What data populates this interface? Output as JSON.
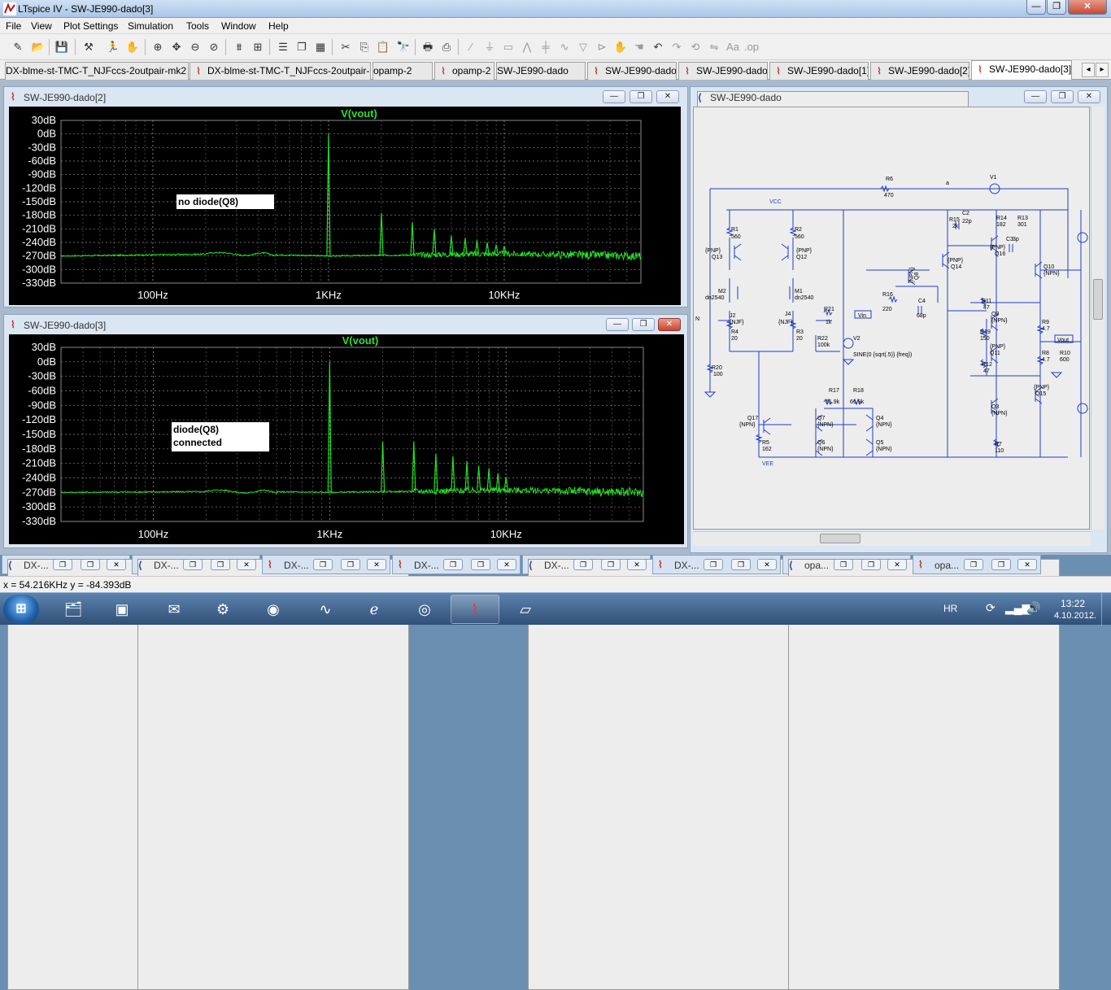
{
  "app": {
    "title": "LTspice IV - SW-JE990-dado[3]"
  },
  "window_buttons": {
    "minimize": "—",
    "restore": "❐",
    "close": "✕"
  },
  "menu": [
    "File",
    "View",
    "Plot Settings",
    "Simulation",
    "Tools",
    "Window",
    "Help"
  ],
  "toolbar_icons": [
    "new-schematic-icon",
    "open-icon",
    "save-icon",
    "control-panel-icon",
    "run-icon",
    "halt-icon",
    "zoom-in-icon",
    "pan-icon",
    "zoom-out-icon",
    "zoom-cancel-icon",
    "autorange-icon",
    "zoom-full-icon",
    "tile-horizontal-icon",
    "cascade-icon",
    "tile-vertical-icon",
    "cut-icon",
    "copy-icon",
    "paste-icon",
    "find-icon",
    "print-setup-icon",
    "print-icon",
    "wire-icon",
    "ground-icon",
    "label-net-icon",
    "resistor-icon",
    "capacitor-icon",
    "inductor-icon",
    "diode-icon",
    "component-icon",
    "move-icon",
    "drag-icon",
    "undo-icon",
    "redo-icon",
    "rotate-icon",
    "mirror-icon",
    "text-icon",
    "spice-directive-icon"
  ],
  "tabs": [
    {
      "label": "DX-blme-st-TMC-T_NJFccs-2outpair-mk2",
      "kind": "schematic"
    },
    {
      "label": "DX-blme-st-TMC-T_NJFccs-2outpair-mk2",
      "kind": "plot"
    },
    {
      "label": "opamp-2",
      "kind": "schematic"
    },
    {
      "label": "opamp-2",
      "kind": "plot"
    },
    {
      "label": "SW-JE990-dado",
      "kind": "schematic"
    },
    {
      "label": "SW-JE990-dado",
      "kind": "plot"
    },
    {
      "label": "SW-JE990-dado",
      "kind": "plot"
    },
    {
      "label": "SW-JE990-dado[1]",
      "kind": "plot"
    },
    {
      "label": "SW-JE990-dado[2]",
      "kind": "plot"
    },
    {
      "label": "SW-JE990-dado[3]",
      "kind": "plot",
      "active": true
    }
  ],
  "plot_windows": [
    {
      "title": "SW-JE990-dado[2]",
      "trace": "V(vout)",
      "annotation": [
        "no diode(Q8)"
      ],
      "y_ticks": [
        "30dB",
        "0dB",
        "-30dB",
        "-60dB",
        "-90dB",
        "-120dB",
        "-150dB",
        "-180dB",
        "-210dB",
        "-240dB",
        "-270dB",
        "-300dB",
        "-330dB"
      ],
      "x_ticks": [
        "100Hz",
        "1KHz",
        "10KHz"
      ]
    },
    {
      "title": "SW-JE990-dado[3]",
      "trace": "V(vout)",
      "annotation": [
        "diode(Q8)",
        "connected"
      ],
      "y_ticks": [
        "30dB",
        "0dB",
        "-30dB",
        "-60dB",
        "-90dB",
        "-120dB",
        "-150dB",
        "-180dB",
        "-210dB",
        "-240dB",
        "-270dB",
        "-300dB",
        "-330dB"
      ],
      "x_ticks": [
        "100Hz",
        "1KHz",
        "10KHz"
      ]
    }
  ],
  "schematic_window": {
    "title": "SW-JE990-dado",
    "labels": {
      "vcc": "VCC",
      "vee": "VEE",
      "a": "a",
      "vin": "Vin",
      "vout": "Vout",
      "in": "N",
      "r6": "R6",
      "r6v": "470",
      "v1": "V1",
      "v2": "V2",
      "v2src": "SINE(0 {sqrt(.5)} {freq})",
      "r1": "R1",
      "r1v": "560",
      "r2": "R2",
      "r2v": "560",
      "q13": "Q13",
      "q12": "Q12",
      "pnp": "{PNP}",
      "npn": "{NPN}",
      "m2": "M2",
      "m1": "M1",
      "dn": "dn2540",
      "j2": "J2",
      "j4": "J4",
      "njf": "{NJF}",
      "r4": "R4",
      "r3": "R3",
      "r20v": "20",
      "r21": "R21",
      "r21v": "1k",
      "r22": "R22",
      "r22v": "100k",
      "r20": "R20",
      "r20b": "100",
      "r16": "R16",
      "r16v": "220",
      "c4": "C4",
      "c4v": "68p",
      "r15": "R15",
      "r15v": "2k",
      "c2": "C2",
      "c2v": "22p",
      "r14": "R14",
      "r14v": "182",
      "r13": "R13",
      "r13v": "301",
      "c3": "C3",
      "c3v": "3p",
      "q14": "Q14",
      "q16": "Q16",
      "q10": "Q10",
      "q9": "Q9",
      "q11": "Q11",
      "q8": "Q8",
      "q15": "Q15",
      "q3": "Q3",
      "r11": "R11",
      "r11v": "47",
      "r19": "R19",
      "r19v": "150",
      "r12": "R12",
      "r12v": "47",
      "r9": "R9",
      "r9v": "4.7",
      "r8": "R8",
      "r8v": "4.7",
      "r10": "R10",
      "r10v": "600",
      "r17": "R17",
      "r17v": "61.9k",
      "r18": "R18",
      "r18v": "61.9k",
      "q17": "Q17",
      "q7": "Q7",
      "q6": "Q6",
      "q4": "Q4",
      "q5": "Q5",
      "r5": "R5",
      "r5v": "162",
      "r7": "R7",
      "r7v": "110"
    }
  },
  "minimized_windows": [
    {
      "label": "DX-...",
      "kind": "schematic"
    },
    {
      "label": "DX-...",
      "kind": "plot"
    },
    {
      "label": "DX-...",
      "kind": "schematic"
    },
    {
      "label": "DX-...",
      "kind": "plot"
    },
    {
      "label": "DX-...",
      "kind": "schematic"
    },
    {
      "label": "DX-...",
      "kind": "plot"
    },
    {
      "label": "opa...",
      "kind": "schematic"
    },
    {
      "label": "opa...",
      "kind": "plot"
    }
  ],
  "status": {
    "cursor": "x = 54.216KHz   y = -84.393dB"
  },
  "taskbar": {
    "apps": [
      "explorer",
      "media-center",
      "mail",
      "tools",
      "browser-red",
      "scope",
      "ie",
      "chrome",
      "ltspice",
      "notes"
    ],
    "lang": "HR",
    "time": "13:22",
    "date": "4.10.2012."
  },
  "colors": {
    "trace": "#22e022",
    "trace_label": "#2ee02e",
    "grid": "#8a8a8a",
    "plot_bg": "#000000",
    "schematic_wire": "#1f3fc8"
  },
  "chart_data": [
    {
      "type": "line",
      "title": "V(vout)",
      "xlabel": "",
      "ylabel": "",
      "x_scale": "log",
      "xlim": [
        30,
        60000
      ],
      "ylim": [
        -330,
        30
      ],
      "series": [
        {
          "name": "V(vout)",
          "peaks": [
            {
              "x": 1000,
              "y": 0
            },
            {
              "x": 2000,
              "y": -175
            },
            {
              "x": 3000,
              "y": -195
            },
            {
              "x": 4000,
              "y": -210
            },
            {
              "x": 5000,
              "y": -225
            },
            {
              "x": 6000,
              "y": -230
            },
            {
              "x": 7000,
              "y": -235
            },
            {
              "x": 8000,
              "y": -240
            },
            {
              "x": 9000,
              "y": -245
            },
            {
              "x": 10000,
              "y": -248
            }
          ],
          "floor": [
            {
              "x": 30,
              "y": -270
            },
            {
              "x": 300,
              "y": -265
            },
            {
              "x": 1000,
              "y": -270
            },
            {
              "x": 10000,
              "y": -265
            },
            {
              "x": 60000,
              "y": -270
            }
          ]
        }
      ]
    },
    {
      "type": "line",
      "title": "V(vout)",
      "xlabel": "",
      "ylabel": "",
      "x_scale": "log",
      "xlim": [
        30,
        60000
      ],
      "ylim": [
        -330,
        30
      ],
      "series": [
        {
          "name": "V(vout)",
          "peaks": [
            {
              "x": 1000,
              "y": 0
            },
            {
              "x": 2000,
              "y": -165
            },
            {
              "x": 3000,
              "y": -165
            },
            {
              "x": 4000,
              "y": -190
            },
            {
              "x": 5000,
              "y": -195
            },
            {
              "x": 6000,
              "y": -205
            },
            {
              "x": 7000,
              "y": -215
            },
            {
              "x": 8000,
              "y": -220
            },
            {
              "x": 9000,
              "y": -230
            },
            {
              "x": 10000,
              "y": -238
            }
          ],
          "floor": [
            {
              "x": 30,
              "y": -270
            },
            {
              "x": 300,
              "y": -268
            },
            {
              "x": 1000,
              "y": -270
            },
            {
              "x": 10000,
              "y": -265
            },
            {
              "x": 60000,
              "y": -270
            }
          ]
        }
      ]
    }
  ]
}
